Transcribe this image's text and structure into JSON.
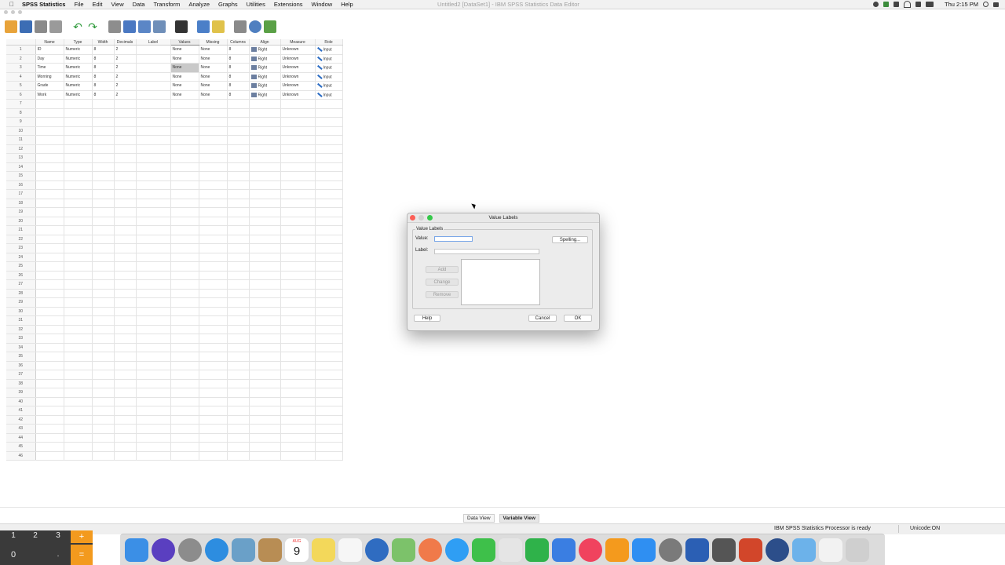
{
  "menubar": {
    "app_name": "SPSS Statistics",
    "items": [
      "File",
      "Edit",
      "View",
      "Data",
      "Transform",
      "Analyze",
      "Graphs",
      "Utilities",
      "Extensions",
      "Window",
      "Help"
    ],
    "window_title": "Untitled2 [DataSet1] - IBM SPSS Statistics Data Editor",
    "clock": "Thu 2:15 PM"
  },
  "grid": {
    "columns": [
      "Name",
      "Type",
      "Width",
      "Decimals",
      "Label",
      "Values",
      "Missing",
      "Columns",
      "Align",
      "Measure",
      "Role"
    ],
    "rows": [
      {
        "num": "1",
        "name": "ID",
        "type": "Numeric",
        "width": "8",
        "decimals": "2",
        "label": "",
        "values": "None",
        "missing": "None",
        "columns": "8",
        "align": "Right",
        "measure": "Unknown",
        "role": "Input"
      },
      {
        "num": "2",
        "name": "Day",
        "type": "Numeric",
        "width": "8",
        "decimals": "2",
        "label": "",
        "values": "None",
        "missing": "None",
        "columns": "8",
        "align": "Right",
        "measure": "Unknown",
        "role": "Input"
      },
      {
        "num": "3",
        "name": "Time",
        "type": "Numeric",
        "width": "8",
        "decimals": "2",
        "label": "",
        "values": "None",
        "missing": "None",
        "columns": "8",
        "align": "Right",
        "measure": "Unknown",
        "role": "Input"
      },
      {
        "num": "4",
        "name": "Morning",
        "type": "Numeric",
        "width": "8",
        "decimals": "2",
        "label": "",
        "values": "None",
        "missing": "None",
        "columns": "8",
        "align": "Right",
        "measure": "Unknown",
        "role": "Input"
      },
      {
        "num": "5",
        "name": "Grade",
        "type": "Numeric",
        "width": "8",
        "decimals": "2",
        "label": "",
        "values": "None",
        "missing": "None",
        "columns": "8",
        "align": "Right",
        "measure": "Unknown",
        "role": "Input"
      },
      {
        "num": "6",
        "name": "Work",
        "type": "Numeric",
        "width": "8",
        "decimals": "2",
        "label": "",
        "values": "None",
        "missing": "None",
        "columns": "8",
        "align": "Right",
        "measure": "Unknown",
        "role": "Input"
      }
    ],
    "empty_row_numbers": [
      "7",
      "8",
      "9",
      "10",
      "11",
      "12",
      "13",
      "14",
      "15",
      "16",
      "17",
      "18",
      "19",
      "20",
      "21",
      "22",
      "23",
      "24",
      "25",
      "26",
      "27",
      "28",
      "29",
      "30",
      "31",
      "32",
      "33",
      "34",
      "35",
      "36",
      "37",
      "38",
      "39",
      "40",
      "41",
      "42",
      "43",
      "44",
      "45",
      "46"
    ]
  },
  "dialog": {
    "title": "Value Labels",
    "group_label": "Value Labels",
    "value_label": "Value:",
    "label_label": "Label:",
    "value_input": "",
    "label_input": "",
    "spelling_button": "Spelling...",
    "add_button": "Add",
    "change_button": "Change",
    "remove_button": "Remove",
    "help_button": "Help",
    "cancel_button": "Cancel",
    "ok_button": "OK"
  },
  "tabs": {
    "data_view": "Data View",
    "variable_view": "Variable View"
  },
  "status": {
    "processor": "IBM SPSS Statistics Processor is ready",
    "unicode": "Unicode:ON"
  },
  "calculator": {
    "keys": [
      "1",
      "2",
      "3",
      "+",
      "0",
      ".",
      "="
    ]
  },
  "dock": {
    "calendar_month": "AUG",
    "calendar_day": "9"
  },
  "colors": {
    "dialog_bg": "#ececec",
    "selected_cell": "#c9c9c9",
    "focus_ring": "#7aa7e8",
    "close_red": "#fc5f57",
    "minimize_gray": "#d1d1d1",
    "zoom_green": "#35c84a"
  }
}
